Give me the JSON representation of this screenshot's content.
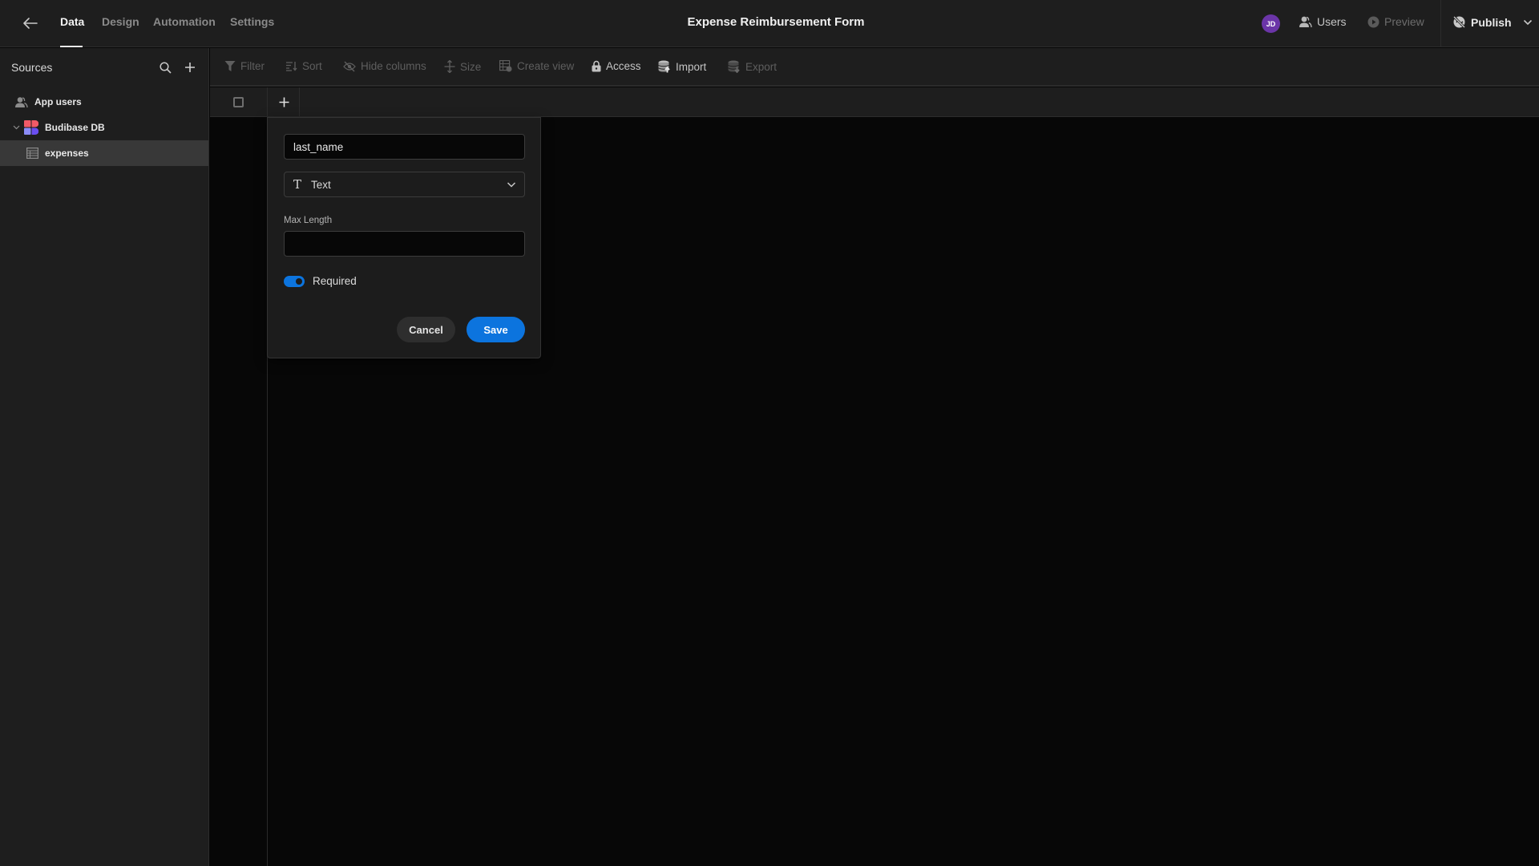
{
  "header": {
    "tabs": [
      {
        "label": "Data",
        "active": true
      },
      {
        "label": "Design",
        "active": false
      },
      {
        "label": "Automation",
        "active": false
      },
      {
        "label": "Settings",
        "active": false
      }
    ],
    "title": "Expense Reimbursement Form",
    "avatar_initials": "JD",
    "avatar_color": "#6b35a8",
    "users_label": "Users",
    "preview_label": "Preview",
    "publish_label": "Publish"
  },
  "sidebar": {
    "title": "Sources",
    "items": [
      {
        "label": "App users",
        "icon": "user-group-icon"
      },
      {
        "label": "Budibase DB",
        "icon": "budibase-logo-icon",
        "expanded": true
      },
      {
        "label": "expenses",
        "icon": "table-icon",
        "selected": true
      }
    ]
  },
  "toolbar": {
    "items": [
      {
        "label": "Filter",
        "icon": "filter-icon"
      },
      {
        "label": "Sort",
        "icon": "sort-icon"
      },
      {
        "label": "Hide columns",
        "icon": "visibility-off-icon"
      },
      {
        "label": "Size",
        "icon": "row-height-icon"
      },
      {
        "label": "Create view",
        "icon": "table-view-icon"
      },
      {
        "label": "Access",
        "icon": "lock-icon"
      },
      {
        "label": "Import",
        "icon": "database-import-icon"
      },
      {
        "label": "Export",
        "icon": "database-export-icon"
      }
    ]
  },
  "column_popover": {
    "name_value": "last_name",
    "type_value": "Text",
    "max_length_label": "Max Length",
    "max_length_value": "",
    "required_label": "Required",
    "required": true,
    "cancel_label": "Cancel",
    "save_label": "Save",
    "accent_color": "#0c74de"
  }
}
